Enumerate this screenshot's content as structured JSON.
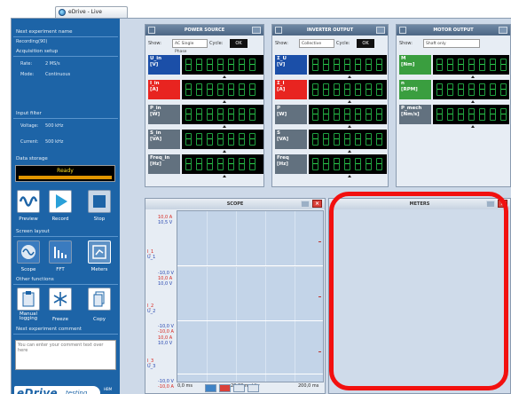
{
  "window": {
    "tab_title": "eDrive - Live"
  },
  "sidebar": {
    "next_experiment_name_label": "Next experiment name",
    "next_experiment_name_value": "Recording(90)",
    "acquisition_setup_label": "Acquisition setup",
    "rate_label": "Rate:",
    "rate_value": "2 MS/s",
    "mode_label": "Mode:",
    "mode_value": "Continuous",
    "input_filter_label": "Input filter",
    "voltage_label": "Voltage:",
    "voltage_value": "500 kHz",
    "current_label": "Current:",
    "current_value": "500 kHz",
    "data_storage_label": "Data storage",
    "status_text": "Ready",
    "buttons": {
      "preview": "Preview",
      "record": "Record",
      "stop": "Stop"
    },
    "screen_layout_label": "Screen layout",
    "layout_buttons": {
      "scope": "Scope",
      "fft": "FFT",
      "meters": "Meters"
    },
    "other_functions_label": "Other functions",
    "function_buttons": {
      "manual_logging": "Manual logging",
      "freeze": "Freeze",
      "copy": "Copy"
    },
    "next_comment_label": "Next experiment comment",
    "comment_placeholder": "You can enter your comment text over here",
    "logo_main": "eDrive",
    "logo_sub": "testing",
    "logo_tm": "HBM"
  },
  "power_source": {
    "title": "POWER SOURCE",
    "show_label": "Show:",
    "show_value": "AC Single Phase",
    "cycle_label": "Cycle:",
    "ok": "OK",
    "channels": [
      {
        "name": "U_in",
        "unit": "[V]"
      },
      {
        "name": "I_in",
        "unit": "[A]"
      },
      {
        "name": "P_in",
        "unit": "[W]"
      },
      {
        "name": "S_in",
        "unit": "[VA]"
      },
      {
        "name": "Freq_in",
        "unit": "[Hz]"
      }
    ]
  },
  "inverter_output": {
    "title": "INVERTER OUTPUT",
    "show_label": "Show:",
    "show_value": "Collective",
    "cycle_label": "Cycle:",
    "ok": "OK",
    "channels": [
      {
        "name": "Σ_U",
        "unit": "[V]"
      },
      {
        "name": "Σ_I",
        "unit": "[A]"
      },
      {
        "name": "P",
        "unit": "[W]"
      },
      {
        "name": "S",
        "unit": "[VA]"
      },
      {
        "name": "Freq",
        "unit": "[Hz]"
      }
    ]
  },
  "motor_output": {
    "title": "MOTOR OUTPUT",
    "show_label": "Show:",
    "show_value": "Shaft only",
    "channels": [
      {
        "name": "M",
        "unit": "[Nm]"
      },
      {
        "name": "n",
        "unit": "[RPM]"
      },
      {
        "name": "P_mech",
        "unit": "[Nm/s]"
      }
    ]
  },
  "scope": {
    "title": "SCOPE",
    "labels": [
      {
        "text": "10,0 A",
        "color": "red"
      },
      {
        "text": "10,5 V",
        "color": "blue"
      },
      {
        "text": "I_1",
        "color": "red"
      },
      {
        "text": "U_1",
        "color": "blue"
      },
      {
        "text": "-10,0 V",
        "color": "blue"
      },
      {
        "text": "10,0 A",
        "color": "red"
      },
      {
        "text": "10,0 V",
        "color": "blue"
      },
      {
        "text": "I_2",
        "color": "red"
      },
      {
        "text": "U_2",
        "color": "blue"
      },
      {
        "text": "-10,0 V",
        "color": "blue"
      },
      {
        "text": "-10,0 A",
        "color": "red"
      },
      {
        "text": "10,0 A",
        "color": "red"
      },
      {
        "text": "10,0 V",
        "color": "blue"
      },
      {
        "text": "I_3",
        "color": "red"
      },
      {
        "text": "U_3",
        "color": "blue"
      },
      {
        "text": "-10,0 V",
        "color": "blue"
      },
      {
        "text": "-10,0 A",
        "color": "red"
      }
    ],
    "x_start": "0,0 ms",
    "x_div": "20,00 ms/div",
    "x_end": "200,0 ms"
  },
  "meters": {
    "title": "METERS"
  },
  "colors": {
    "accent": "#1d64a7",
    "highlight": "#f2100f",
    "digit_green": "#1fa040"
  }
}
